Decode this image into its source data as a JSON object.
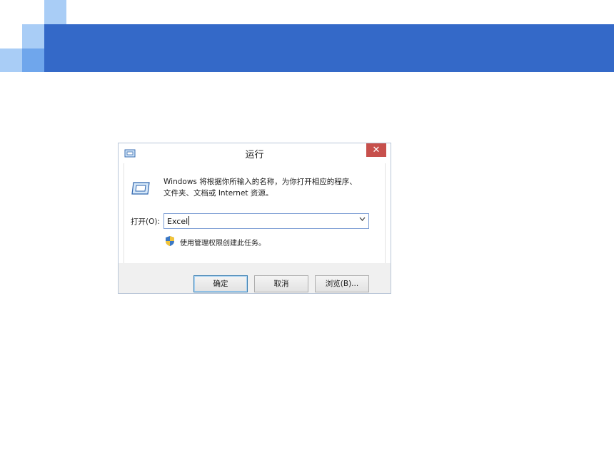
{
  "dialog": {
    "title": "运行",
    "close_symbol": "✕",
    "description": "Windows 将根据你所输入的名称，为你打开相应的程序、文件夹、文档或 Internet 资源。",
    "description_line1": "Windows 将根据你所输入的名称，为你打开相应的程序、",
    "description_line2": "文件夹、文档或 Internet 资源。",
    "open_label": "打开(O):",
    "open_value": "Excel",
    "admin_text": "使用管理权限创建此任务。",
    "buttons": {
      "ok": "确定",
      "cancel": "取消",
      "browse": "浏览(B)..."
    }
  },
  "icons": {
    "title": "run-icon",
    "large": "run-icon",
    "admin": "shield-icon",
    "dropdown": "chevron-down-icon",
    "close": "close-icon"
  },
  "colors": {
    "banner": "#3469c8",
    "close_button": "#c7504c",
    "default_button_border": "#3c7fb1"
  }
}
